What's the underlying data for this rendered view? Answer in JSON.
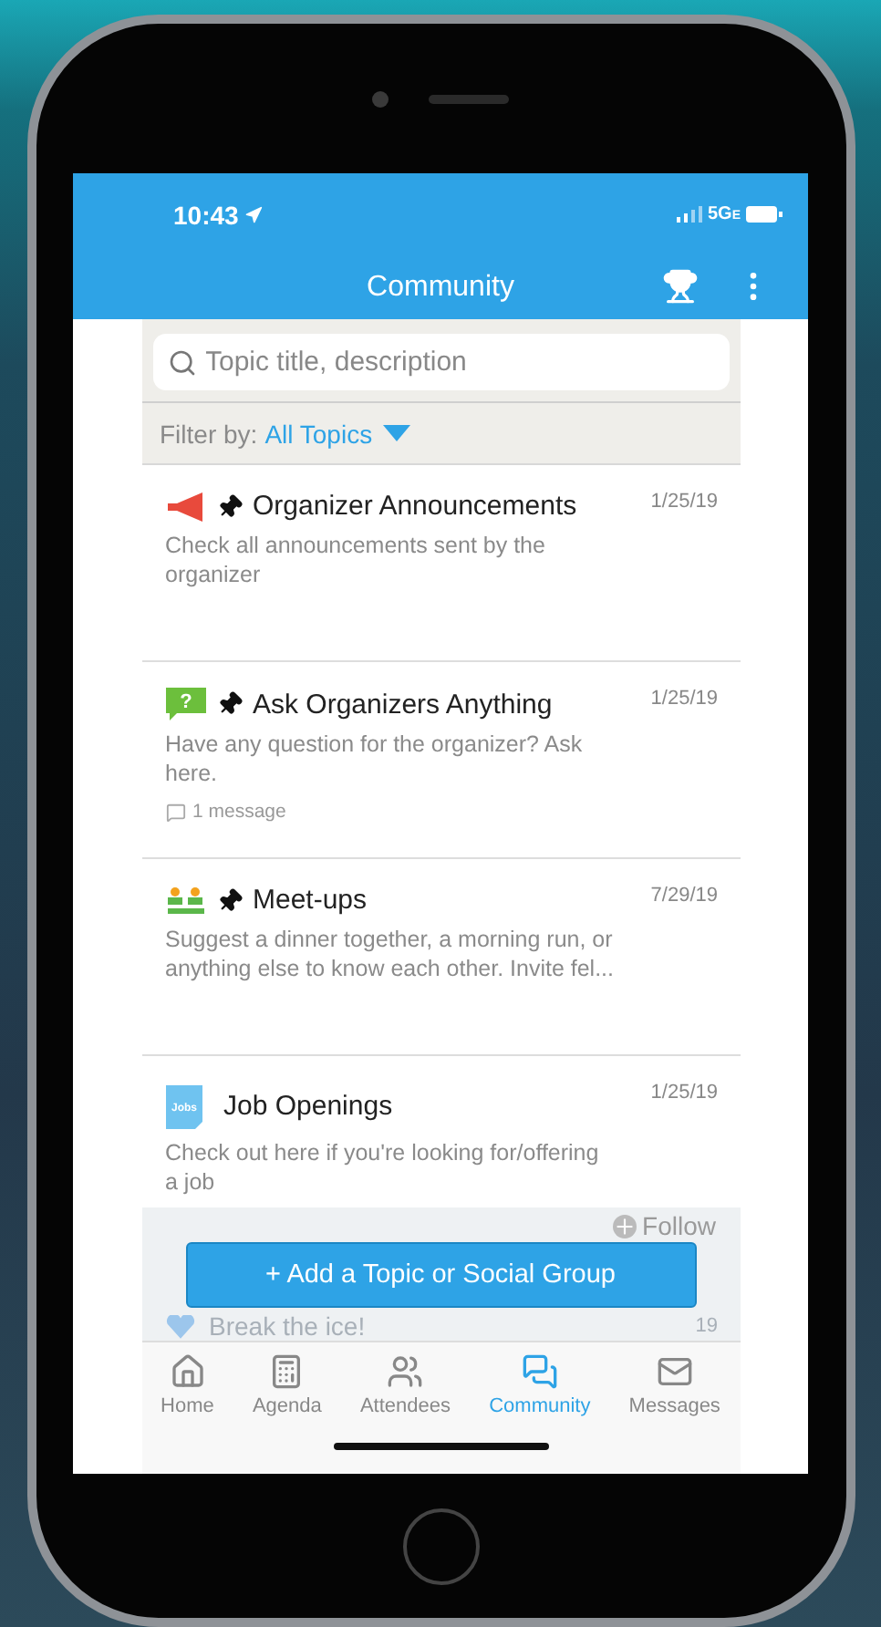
{
  "status_bar": {
    "time": "10:43",
    "network": "5G",
    "network_suffix": "E"
  },
  "header": {
    "title": "Community"
  },
  "search": {
    "placeholder": "Topic title, description"
  },
  "filter": {
    "label": "Filter by:",
    "value": "All Topics"
  },
  "topics": [
    {
      "kind": "megaphone",
      "pinned": true,
      "title": "Organizer Announcements",
      "date": "1/25/19",
      "description": "Check all announcements sent by the organizer"
    },
    {
      "kind": "question",
      "icon_label": "?",
      "pinned": true,
      "title": "Ask Organizers Anything",
      "date": "1/25/19",
      "description": "Have any question for the organizer? Ask here.",
      "messages": "1 message"
    },
    {
      "kind": "people",
      "pinned": true,
      "title": "Meet-ups",
      "date": "7/29/19",
      "description": "Suggest a dinner together, a morning run, or anything else to know each other. Invite fel..."
    },
    {
      "kind": "jobs",
      "pinned": false,
      "title": "Job Openings",
      "date": "1/25/19",
      "icon_label": "Jobs",
      "description": "Check out here if you're looking for/offering a job",
      "follow": "Follow"
    }
  ],
  "add_button": "+ Add a Topic or Social Group",
  "partial_topic": {
    "title": "Break the ice!",
    "date": "19"
  },
  "tabs": [
    {
      "kind": "home",
      "label": "Home",
      "selected": false
    },
    {
      "kind": "agenda",
      "label": "Agenda",
      "selected": false
    },
    {
      "kind": "attendees",
      "label": "Attendees",
      "selected": false
    },
    {
      "kind": "community",
      "label": "Community",
      "selected": true
    },
    {
      "kind": "messages",
      "label": "Messages",
      "selected": false
    }
  ]
}
